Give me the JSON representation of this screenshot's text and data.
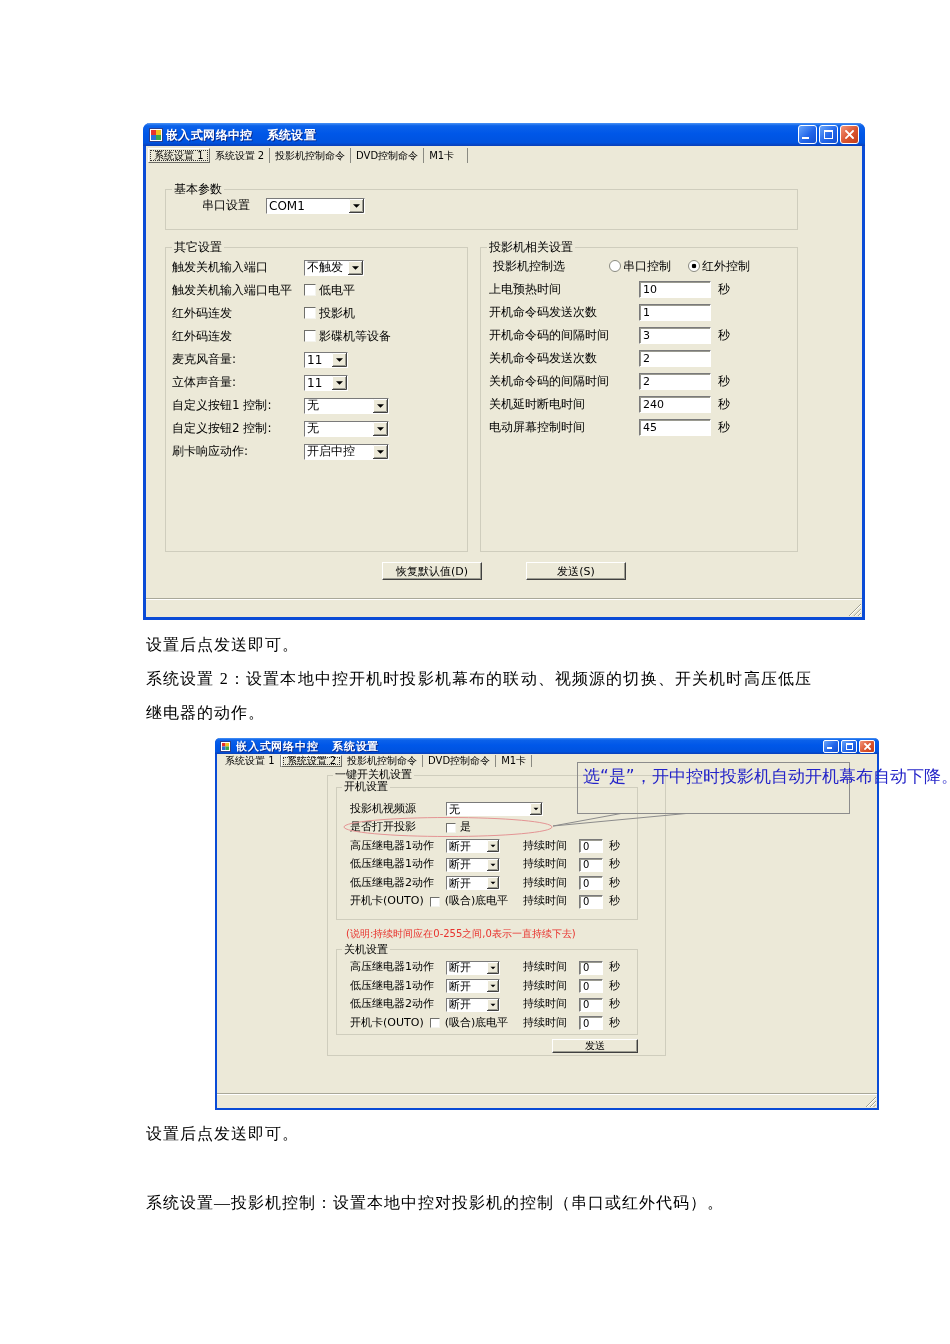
{
  "blocks": [
    {
      "kind": "window",
      "title": "嵌入式网络中控   系统设置",
      "tabs": [
        {
          "label": "系统设置 1",
          "selected": true
        },
        {
          "label": "系统设置 2",
          "selected": false
        },
        {
          "label": "投影机控制命令",
          "selected": false
        },
        {
          "label": "DVD控制命令",
          "selected": false
        },
        {
          "label": "M1卡",
          "selected": false
        }
      ],
      "page": {
        "kind": "general",
        "groups": [
          {
            "kind": "basic",
            "title": "基本参数",
            "rows": [
              {
                "kind": "combo",
                "label": "串口设置",
                "value": "COM1"
              }
            ]
          },
          {
            "kind": "settings",
            "title": "其它设置",
            "rows": [
              {
                "kind": "combo",
                "label": "触发关机输入端口",
                "value": "不触发"
              },
              {
                "kind": "checkbox",
                "label": "触发关机输入端口电平",
                "option": "低电平",
                "checked": false
              },
              {
                "kind": "checkbox",
                "label": "红外码连发",
                "option": "投影机",
                "checked": false
              },
              {
                "kind": "checkbox",
                "label": "红外码连发",
                "option": "影碟机等设备",
                "checked": false
              },
              {
                "kind": "combo",
                "label": "麦克风音量:",
                "value": "11"
              },
              {
                "kind": "combo",
                "label": "立体声音量:",
                "value": "11"
              },
              {
                "kind": "combo",
                "label": "自定义按钮1 控制:",
                "value": "无"
              },
              {
                "kind": "combo",
                "label": "自定义按钮2 控制:",
                "value": "无"
              },
              {
                "kind": "combo",
                "label": "刷卡响应动作:",
                "value": "开启中控"
              }
            ]
          },
          {
            "kind": "projector",
            "title": "投影机相关设置",
            "rows": [
              {
                "kind": "radio",
                "label": "投影机控制选",
                "options": [
                  {
                    "label": "串口控制",
                    "selected": false
                  },
                  {
                    "label": "红外控制",
                    "selected": true
                  }
                ]
              },
              {
                "kind": "input",
                "label": "上电预热时间",
                "value": "10",
                "unit": "秒"
              },
              {
                "kind": "input",
                "label": "开机命令码发送次数",
                "value": "1"
              },
              {
                "kind": "input",
                "label": "开机命令码的间隔时间",
                "value": "3",
                "unit": "秒"
              },
              {
                "kind": "input",
                "label": "关机命令码发送次数",
                "value": "2"
              },
              {
                "kind": "input",
                "label": "关机命令码的间隔时间",
                "value": "2",
                "unit": "秒"
              },
              {
                "kind": "input",
                "label": "关机延时断电时间",
                "value": "240",
                "unit": "秒"
              },
              {
                "kind": "input",
                "label": "电动屏幕控制时间",
                "value": "45",
                "unit": "秒"
              }
            ]
          }
        ],
        "buttons": [
          "恢复默认值(D)",
          "发送(S)"
        ]
      }
    },
    {
      "kind": "paragraph",
      "text": "设置后点发送即可。"
    },
    {
      "kind": "paragraph",
      "text": "系统设置 2：设置本地中控开机时投影机幕布的联动、视频源的切换、开关机时高压低压继电器的动作。"
    },
    {
      "kind": "window",
      "title": "嵌入式网络中控   系统设置",
      "tabs": [
        {
          "label": "系统设置 1",
          "selected": false
        },
        {
          "label": "系统设置 2",
          "selected": true
        },
        {
          "label": "投影机控制命令",
          "selected": false
        },
        {
          "label": "DVD控制命令",
          "selected": false
        },
        {
          "label": "M1卡",
          "selected": false
        }
      ],
      "page": {
        "kind": "relay",
        "group": {
          "title": "一键开关机设置",
          "power_on": {
            "title": "开机设置",
            "rows": [
              {
                "kind": "combo",
                "label": "投影机视频源",
                "value": "无"
              },
              {
                "kind": "checkbox",
                "label": "是否打开投影",
                "option": "是",
                "checked": false
              },
              {
                "kind": "relay",
                "label": "高压继电器1动作",
                "value": "断开",
                "duration_label": "持续时间",
                "duration": "0",
                "unit": "秒"
              },
              {
                "kind": "relay",
                "label": "低压继电器1动作",
                "value": "断开",
                "duration_label": "持续时间",
                "duration": "0",
                "unit": "秒"
              },
              {
                "kind": "relay",
                "label": "低压继电器2动作",
                "value": "断开",
                "duration_label": "持续时间",
                "duration": "0",
                "unit": "秒"
              },
              {
                "kind": "relay_check",
                "label": "开机卡(OUTO)",
                "option": "(吸合)底电平",
                "checked": false,
                "duration_label": "持续时间",
                "duration": "0",
                "unit": "秒"
              }
            ]
          },
          "note": "(说明:持续时间应在0-255之间,0表示一直持续下去)",
          "power_off": {
            "title": "关机设置",
            "rows": [
              {
                "kind": "relay",
                "label": "高压继电器1动作",
                "value": "断开",
                "duration_label": "持续时间",
                "duration": "0",
                "unit": "秒"
              },
              {
                "kind": "relay",
                "label": "低压继电器1动作",
                "value": "断开",
                "duration_label": "持续时间",
                "duration": "0",
                "unit": "秒"
              },
              {
                "kind": "relay",
                "label": "低压继电器2动作",
                "value": "断开",
                "duration_label": "持续时间",
                "duration": "0",
                "unit": "秒"
              },
              {
                "kind": "relay_check",
                "label": "开机卡(OUTO)",
                "option": "(吸合)底电平",
                "checked": false,
                "duration_label": "持续时间",
                "duration": "0",
                "unit": "秒"
              }
            ]
          },
          "button": "发送"
        }
      },
      "annotation": {
        "text": "选“是”，开中控时投影机自动开机幕布自动下降。"
      }
    },
    {
      "kind": "paragraph",
      "text": "设置后点发送即可。"
    },
    {
      "kind": "paragraph",
      "text": "系统设置—投影机控制：设置本地中控对投影机的控制（串口或红外代码）。"
    }
  ]
}
